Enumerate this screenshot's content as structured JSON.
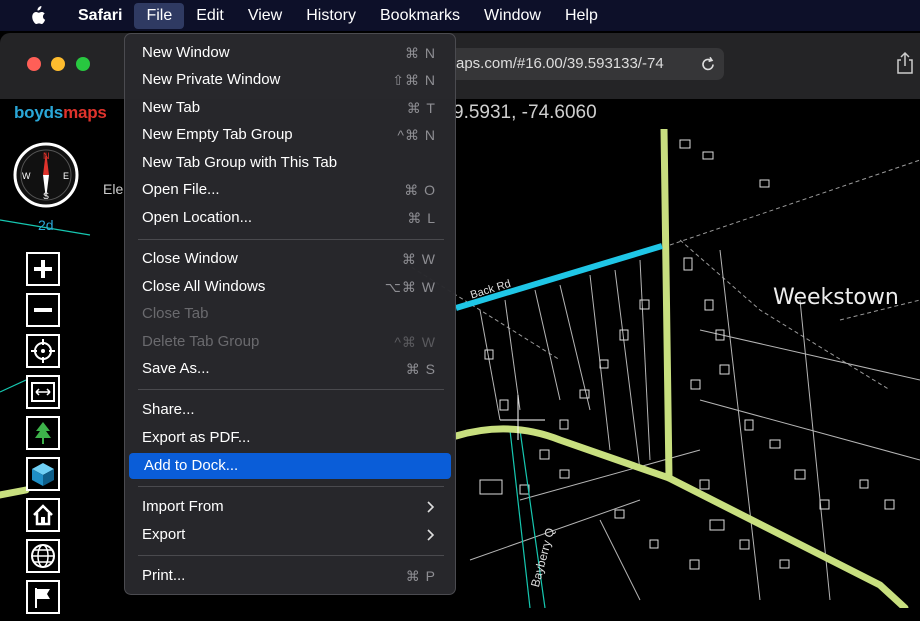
{
  "menubar": {
    "apple_icon": "apple-logo-icon",
    "items": [
      "Safari",
      "File",
      "Edit",
      "View",
      "History",
      "Bookmarks",
      "Window",
      "Help"
    ]
  },
  "browser": {
    "address": "aps.com/#16.00/39.593133/-74",
    "reload_icon": "reload-icon",
    "share_icon": "share-icon"
  },
  "map": {
    "logo_part1": "boyds",
    "logo_part2": "maps",
    "coords": "9.5931, -74.6060",
    "compass_n": "N",
    "compass_s": "S",
    "compass_e": "E",
    "compass_w": "W",
    "mode": "2d",
    "elev_label": "Ele",
    "town": "Weekstown",
    "road_back": "Back Rd",
    "road_bay": "Bayberry Q",
    "colors": {
      "road": "#c8df7f",
      "highlight_road": "#1fc6e6",
      "water": "#16c7b0"
    }
  },
  "file_menu": {
    "items": [
      {
        "label": "New Window",
        "shortcut": "⌘ N",
        "disabled": false
      },
      {
        "label": "New Private Window",
        "shortcut": "⇧⌘ N",
        "disabled": false
      },
      {
        "label": "New Tab",
        "shortcut": "⌘ T",
        "disabled": false
      },
      {
        "label": "New Empty Tab Group",
        "shortcut": "^⌘ N",
        "disabled": false
      },
      {
        "label": "New Tab Group with This Tab",
        "shortcut": "",
        "disabled": false
      },
      {
        "label": "Open File...",
        "shortcut": "⌘ O",
        "disabled": false
      },
      {
        "label": "Open Location...",
        "shortcut": "⌘ L",
        "disabled": false
      },
      {
        "label": "Close Window",
        "shortcut": "⌘ W",
        "disabled": false
      },
      {
        "label": "Close All Windows",
        "shortcut": "⌥⌘ W",
        "disabled": false
      },
      {
        "label": "Close Tab",
        "shortcut": "",
        "disabled": true
      },
      {
        "label": "Delete Tab Group",
        "shortcut": "^⌘ W",
        "disabled": true
      },
      {
        "label": "Save As...",
        "shortcut": "⌘ S",
        "disabled": false
      },
      {
        "label": "Share...",
        "shortcut": "",
        "disabled": false
      },
      {
        "label": "Export as PDF...",
        "shortcut": "",
        "disabled": false
      },
      {
        "label": "Add to Dock...",
        "shortcut": "",
        "disabled": false,
        "highlighted": true
      },
      {
        "label": "Import From",
        "shortcut": "",
        "disabled": false,
        "submenu": true
      },
      {
        "label": "Export",
        "shortcut": "",
        "disabled": false,
        "submenu": true
      },
      {
        "label": "Print...",
        "shortcut": "⌘ P",
        "disabled": false
      }
    ]
  }
}
